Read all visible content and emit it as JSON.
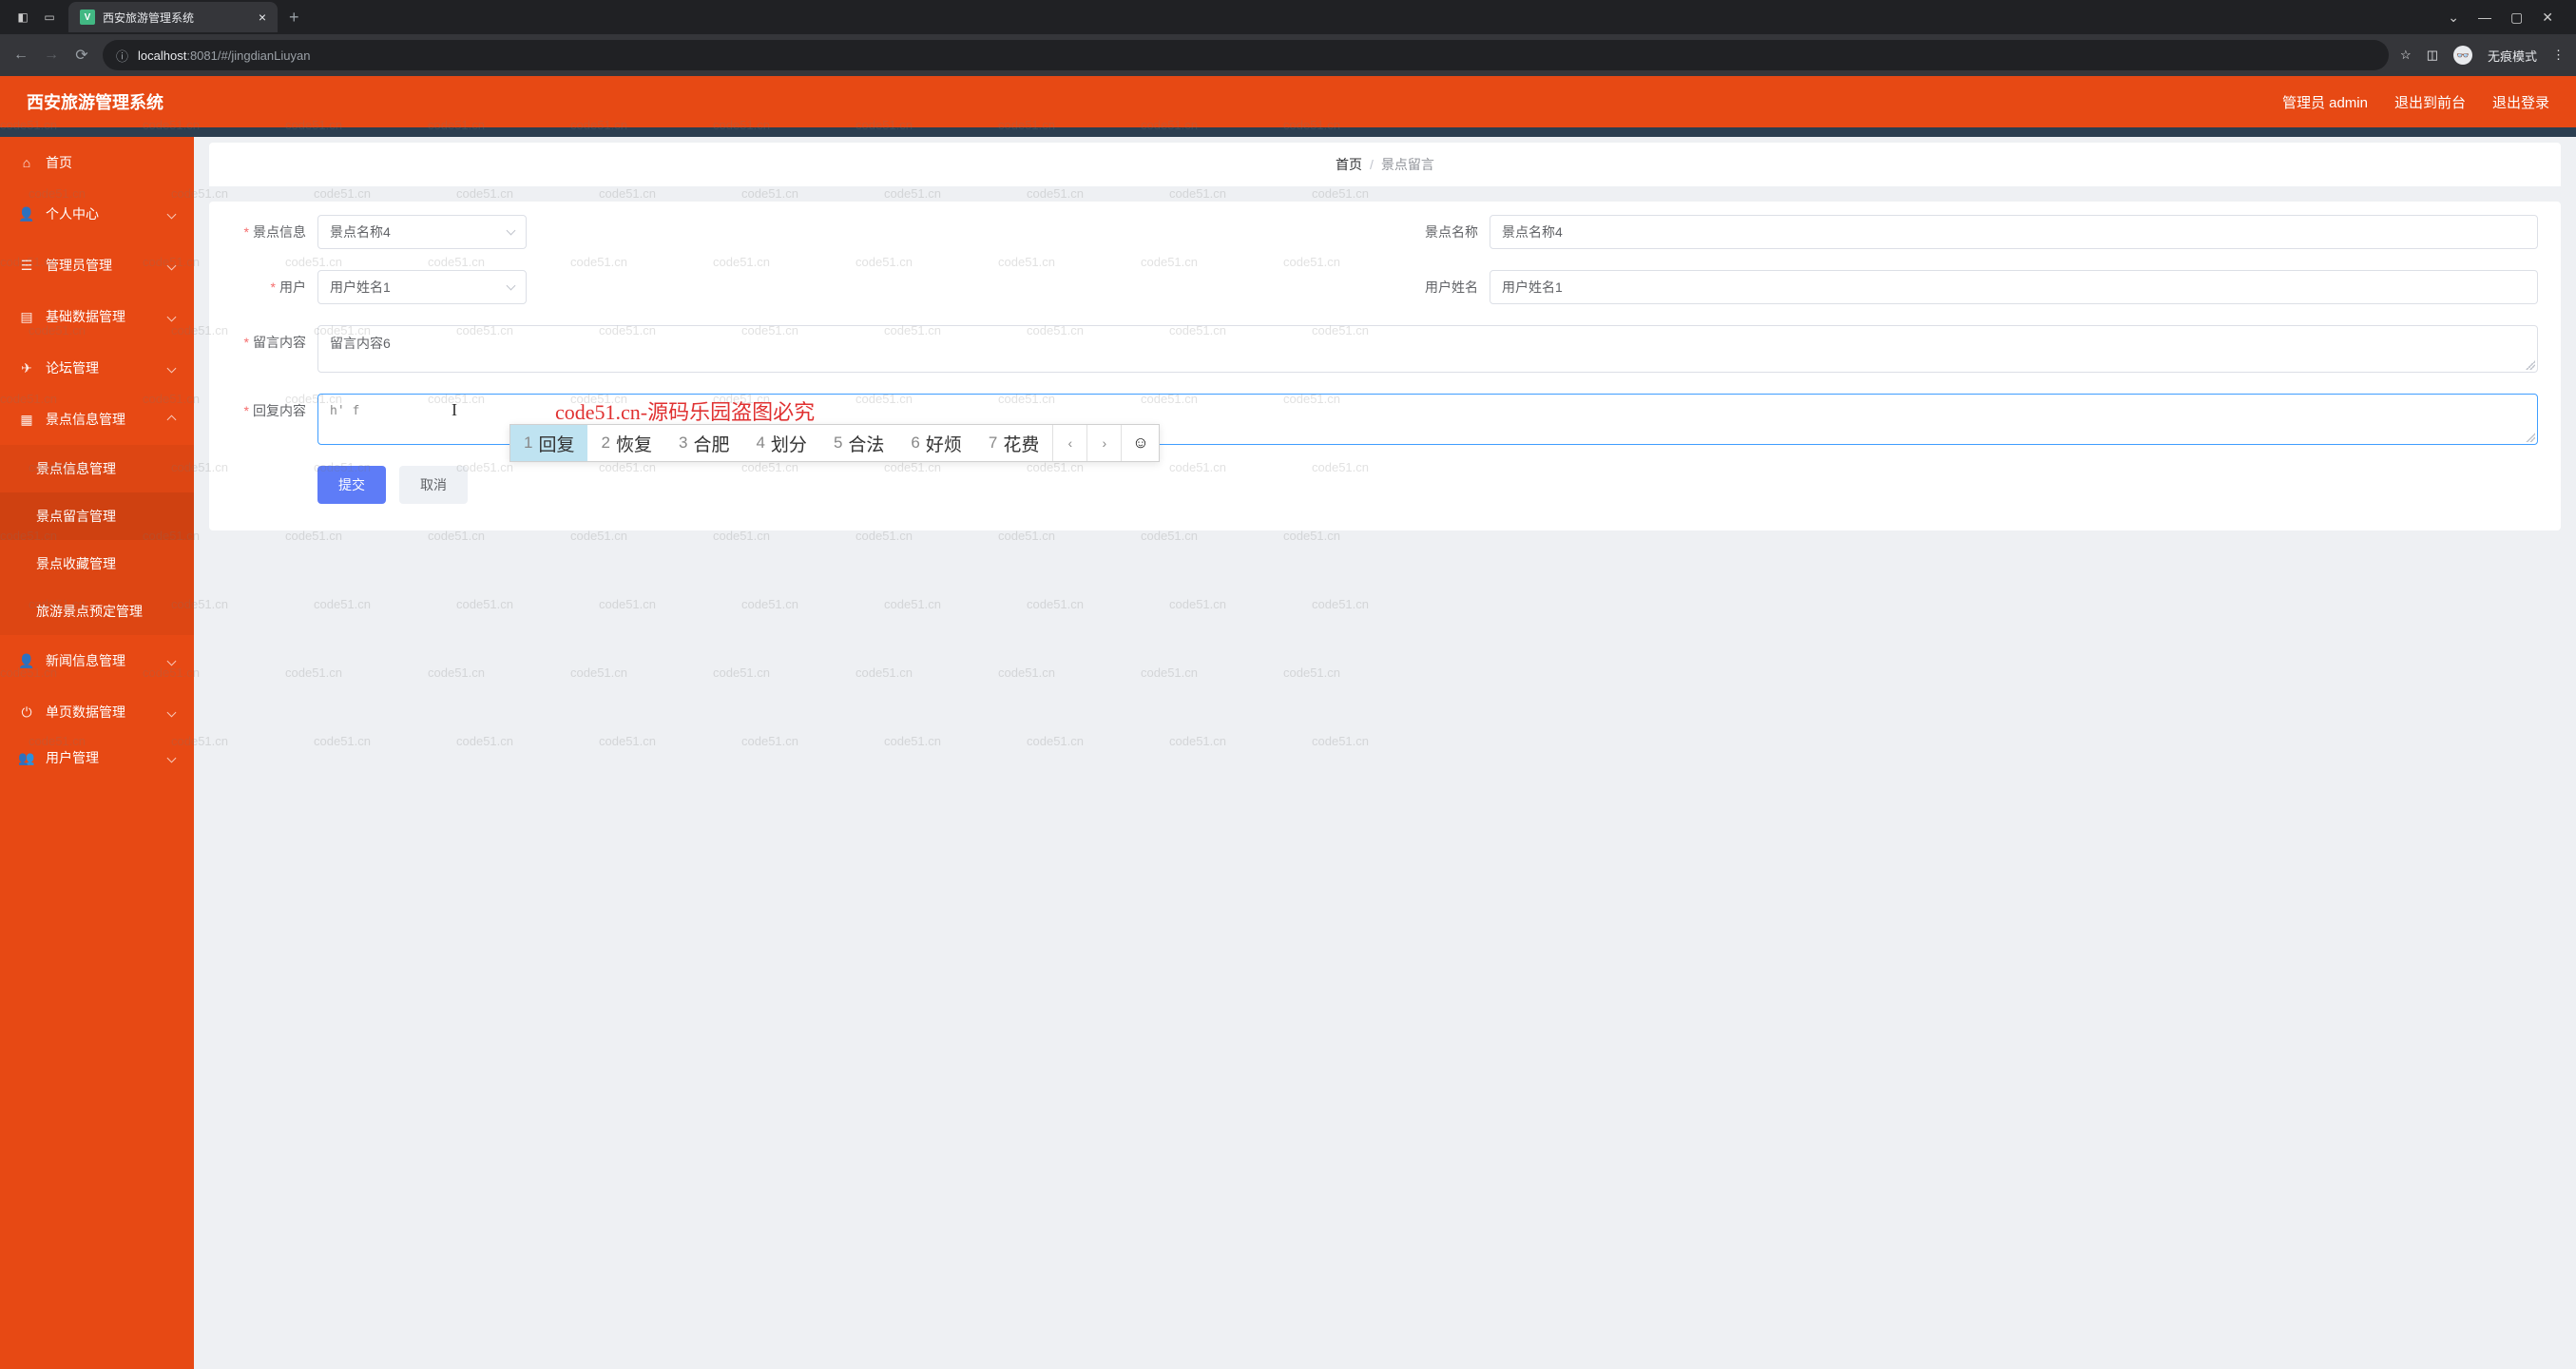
{
  "browser": {
    "tab_title": "西安旅游管理系统",
    "url_host": "localhost",
    "url_port": ":8081",
    "url_path": "/#/jingdianLiuyan",
    "incognito_label": "无痕模式"
  },
  "header": {
    "title": "西安旅游管理系统",
    "user_label": "管理员 admin",
    "exit_front": "退出到前台",
    "logout": "退出登录"
  },
  "sidebar": {
    "items": [
      {
        "icon": "home",
        "label": "首页"
      },
      {
        "icon": "user",
        "label": "个人中心"
      },
      {
        "icon": "list",
        "label": "管理员管理"
      },
      {
        "icon": "db",
        "label": "基础数据管理"
      },
      {
        "icon": "send",
        "label": "论坛管理"
      },
      {
        "icon": "grid",
        "label": "景点信息管理",
        "open": true,
        "children": [
          {
            "label": "景点信息管理"
          },
          {
            "label": "景点留言管理",
            "active": true
          },
          {
            "label": "景点收藏管理"
          },
          {
            "label": "旅游景点预定管理"
          }
        ]
      },
      {
        "icon": "user",
        "label": "新闻信息管理"
      },
      {
        "icon": "power",
        "label": "单页数据管理"
      },
      {
        "icon": "users",
        "label": "用户管理"
      }
    ]
  },
  "breadcrumb": {
    "home": "首页",
    "current": "景点留言"
  },
  "form": {
    "labels": {
      "scenic_info": "景点信息",
      "scenic_name": "景点名称",
      "user": "用户",
      "user_name": "用户姓名",
      "message_content": "留言内容",
      "reply_content": "回复内容"
    },
    "values": {
      "scenic_info": "景点名称4",
      "scenic_name": "景点名称4",
      "user": "用户姓名1",
      "user_name": "用户姓名1",
      "message_content": "留言内容6",
      "reply_typing": "h' f"
    },
    "buttons": {
      "submit": "提交",
      "cancel": "取消"
    }
  },
  "ime": {
    "candidates": [
      {
        "n": "1",
        "w": "回复"
      },
      {
        "n": "2",
        "w": "恢复"
      },
      {
        "n": "3",
        "w": "合肥"
      },
      {
        "n": "4",
        "w": "划分"
      },
      {
        "n": "5",
        "w": "合法"
      },
      {
        "n": "6",
        "w": "好烦"
      },
      {
        "n": "7",
        "w": "花费"
      }
    ]
  },
  "watermark": {
    "text": "code51.cn",
    "red_text": "code51.cn-源码乐园盗图必究"
  }
}
